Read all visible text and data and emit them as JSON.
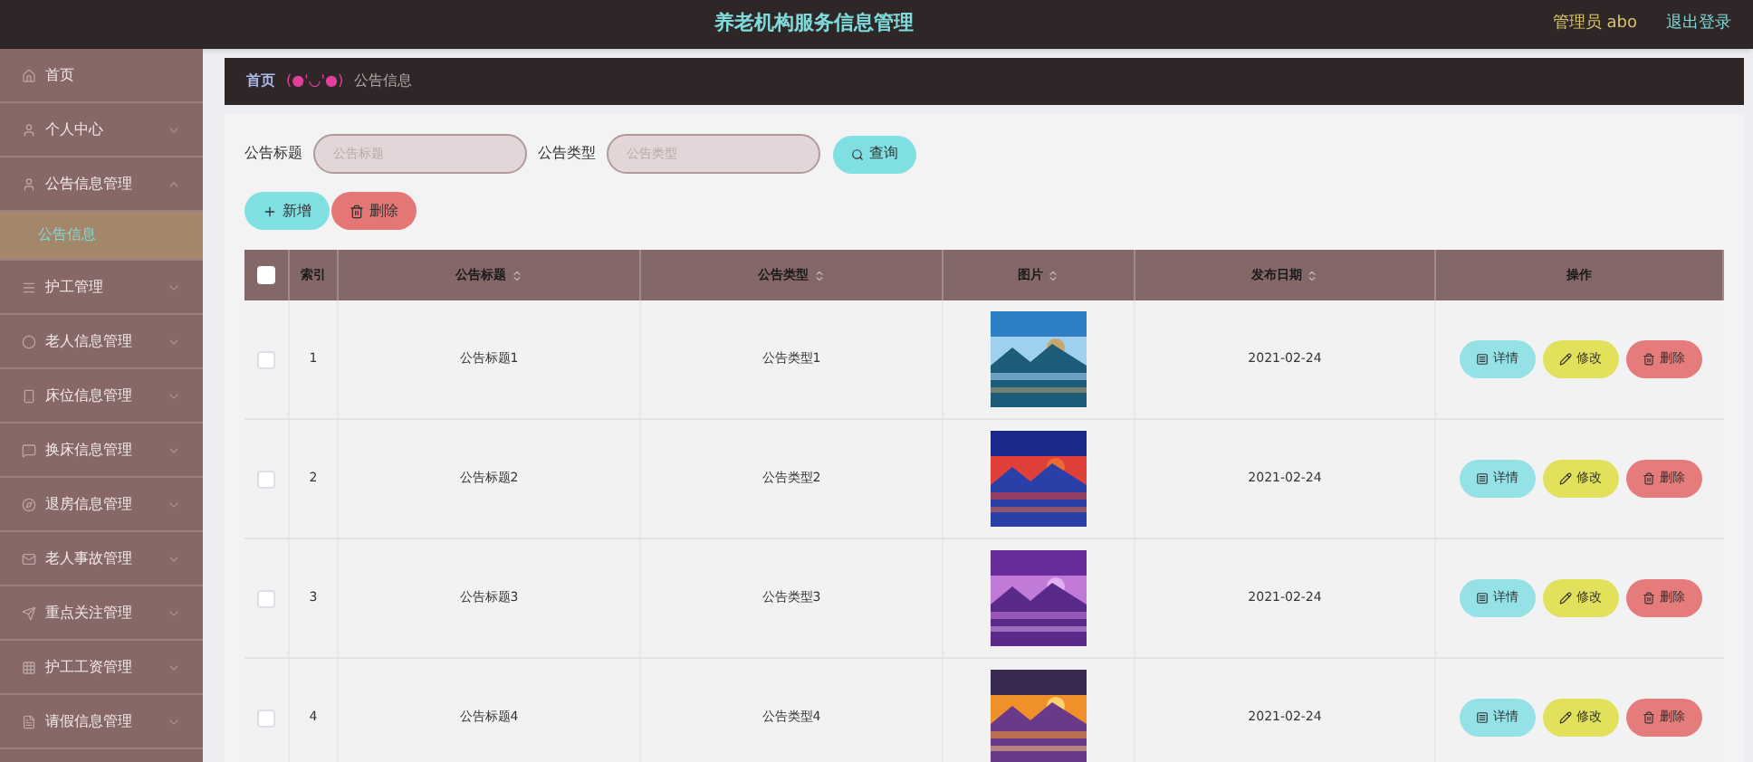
{
  "header": {
    "title": "养老机构服务信息管理",
    "user": "管理员 abo",
    "logout": "退出登录"
  },
  "sidebar": {
    "items": [
      {
        "label": "首页",
        "selected": false
      },
      {
        "label": "个人中心",
        "expanded": false,
        "selected": false
      },
      {
        "label": "公告信息管理",
        "expanded": true,
        "selected": false,
        "children": [
          {
            "label": "公告信息",
            "selected": true
          }
        ]
      },
      {
        "label": "护工管理",
        "expanded": false,
        "selected": false
      },
      {
        "label": "老人信息管理",
        "expanded": false,
        "selected": false
      },
      {
        "label": "床位信息管理",
        "expanded": false,
        "selected": false
      },
      {
        "label": "换床信息管理",
        "expanded": false,
        "selected": false
      },
      {
        "label": "退房信息管理",
        "expanded": false,
        "selected": false
      },
      {
        "label": "老人事故管理",
        "expanded": false,
        "selected": false
      },
      {
        "label": "重点关注管理",
        "expanded": false,
        "selected": false
      },
      {
        "label": "护工工资管理",
        "expanded": false,
        "selected": false
      },
      {
        "label": "请假信息管理",
        "expanded": false,
        "selected": false
      }
    ]
  },
  "breadcrumb": {
    "home": "首页",
    "separator": "(●'◡'●)",
    "current": "公告信息"
  },
  "search": {
    "fields": [
      {
        "label": "公告标题",
        "placeholder": "公告标题"
      },
      {
        "label": "公告类型",
        "placeholder": "公告类型"
      }
    ],
    "button": "查询"
  },
  "actions": {
    "add": "新增",
    "delete": "删除"
  },
  "table": {
    "select_all": {
      "checked": false
    },
    "columns": [
      {
        "label": "索引",
        "sortable": false
      },
      {
        "label": "公告标题",
        "sortable": true
      },
      {
        "label": "公告类型",
        "sortable": true
      },
      {
        "label": "图片",
        "sortable": true
      },
      {
        "label": "发布日期",
        "sortable": true
      },
      {
        "label": "操作",
        "sortable": false
      }
    ],
    "rows": [
      {
        "checked": false,
        "index": "1",
        "title": "公告标题1",
        "type": "公告类型1",
        "image": {
          "kind": "picture"
        },
        "date": "2021-02-24",
        "buttons": [
          "详情",
          "修改",
          "删除"
        ]
      },
      {
        "checked": false,
        "index": "2",
        "title": "公告标题2",
        "type": "公告类型2",
        "image": {
          "kind": "picture"
        },
        "date": "2021-02-24",
        "buttons": [
          "详情",
          "修改",
          "删除"
        ]
      },
      {
        "checked": false,
        "index": "3",
        "title": "公告标题3",
        "type": "公告类型3",
        "image": {
          "kind": "picture"
        },
        "date": "2021-02-24",
        "buttons": [
          "详情",
          "修改",
          "删除"
        ]
      },
      {
        "checked": false,
        "index": "4",
        "title": "公告标题4",
        "type": "公告类型4",
        "image": {
          "kind": "picture"
        },
        "date": "2021-02-24",
        "buttons": [
          "详情",
          "修改",
          "删除"
        ]
      }
    ]
  }
}
